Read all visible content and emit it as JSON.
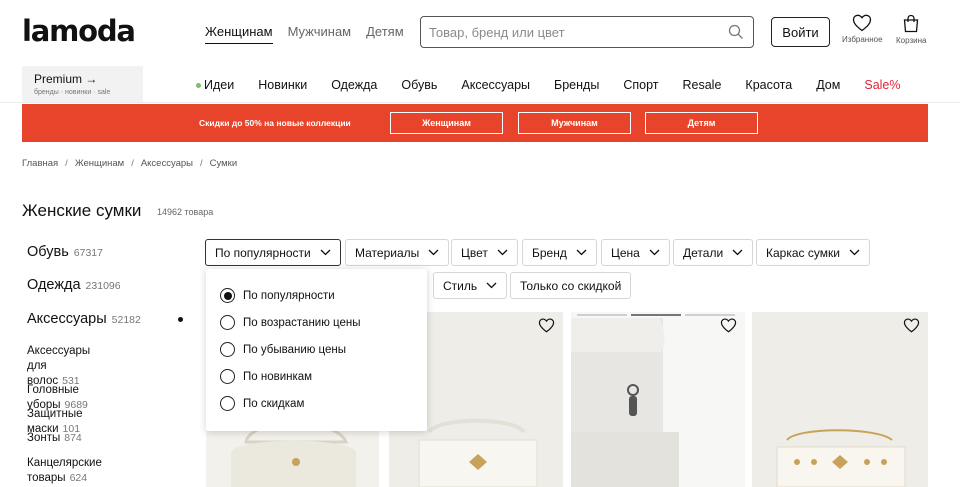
{
  "header": {
    "logo": "lamoda",
    "gender_tabs": [
      "Женщинам",
      "Мужчинам",
      "Детям"
    ],
    "search_placeholder": "Товар, бренд или цвет",
    "login_label": "Войти",
    "favorites_label": "Избранное",
    "cart_label": "Корзина",
    "premium_title": "Premium →",
    "premium_subtitle": "бренды · новинки · sale"
  },
  "category_nav": [
    "Идеи",
    "Новинки",
    "Одежда",
    "Обувь",
    "Аксессуары",
    "Бренды",
    "Спорт",
    "Resale",
    "Красота",
    "Дом",
    "Sale%"
  ],
  "promo": {
    "text": "Скидки до 50% на новые коллекции",
    "buttons": [
      "Женщинам",
      "Мужчинам",
      "Детям"
    ],
    "color": "#e8442b"
  },
  "breadcrumbs": [
    "Главная",
    "Женщинам",
    "Аксессуары",
    "Сумки"
  ],
  "page": {
    "title": "Женские сумки",
    "count": "14962 товара"
  },
  "sidebar": {
    "main": [
      {
        "label": "Обувь",
        "count": "67317"
      },
      {
        "label": "Одежда",
        "count": "231096"
      },
      {
        "label": "Аксессуары",
        "count": "52182"
      }
    ],
    "sub": [
      {
        "label_line1": "Аксессуары для",
        "label_line2": "волос",
        "count": "531"
      },
      {
        "label": "Головные уборы",
        "count": "9689"
      },
      {
        "label": "Защитные маски",
        "count": "101"
      },
      {
        "label": "Зонты",
        "count": "874"
      },
      {
        "label_line1": "Канцелярские",
        "label_line2": "товары",
        "count": "624"
      }
    ]
  },
  "filters": {
    "row1": [
      "По популярности",
      "Материалы",
      "Цвет",
      "Бренд",
      "Цена",
      "Детали",
      "Каркас сумки"
    ],
    "row2": [
      "Стиль",
      "Только со скидкой"
    ]
  },
  "sort_dropdown": {
    "selected": "По популярности",
    "options": [
      "По популярности",
      "По возрастанию цены",
      "По убыванию цены",
      "По новинкам",
      "По скидкам"
    ]
  },
  "colors": {
    "sale": "#e2233a",
    "ideas_dot": "#7bbf6a"
  }
}
